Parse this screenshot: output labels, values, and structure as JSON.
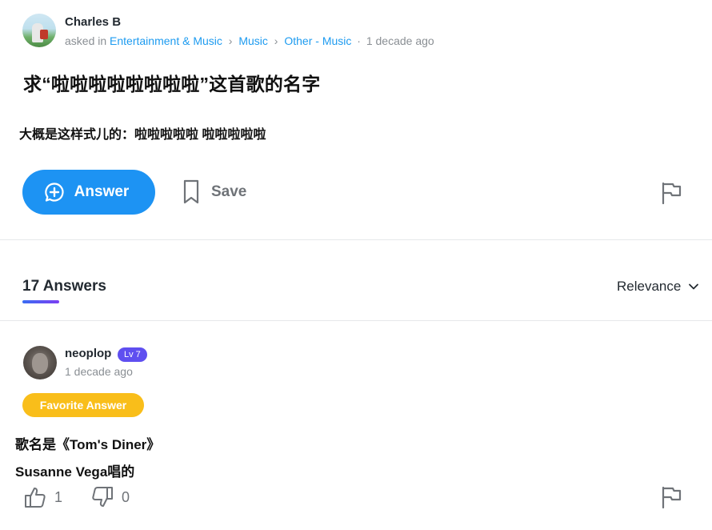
{
  "question": {
    "author": "Charles B",
    "asked_in": "asked in",
    "breadcrumb": [
      "Entertainment & Music",
      "Music",
      "Other - Music"
    ],
    "time": "1 decade ago",
    "title": "求“啦啦啦啦啦啦啦啦”这首歌的名字",
    "body": "大概是这样式儿的：啦啦啦啦啦 啦啦啦啦啦"
  },
  "actions": {
    "answer_label": "Answer",
    "save_label": "Save"
  },
  "answers_header": {
    "count_label": "17 Answers",
    "sort_label": "Relevance"
  },
  "answer": {
    "author": "neoplop",
    "level": "Lv 7",
    "time": "1 decade ago",
    "favorite_label": "Favorite Answer",
    "line1": "歌名是《Tom's Diner》",
    "line2": "Susanne Vega唱的",
    "upvotes": "1",
    "downvotes": "0"
  },
  "colors": {
    "accent": "#1d93f3",
    "link": "#1d9bf0",
    "favorite": "#f9be1a",
    "level_badge": "#5f4ff0"
  }
}
